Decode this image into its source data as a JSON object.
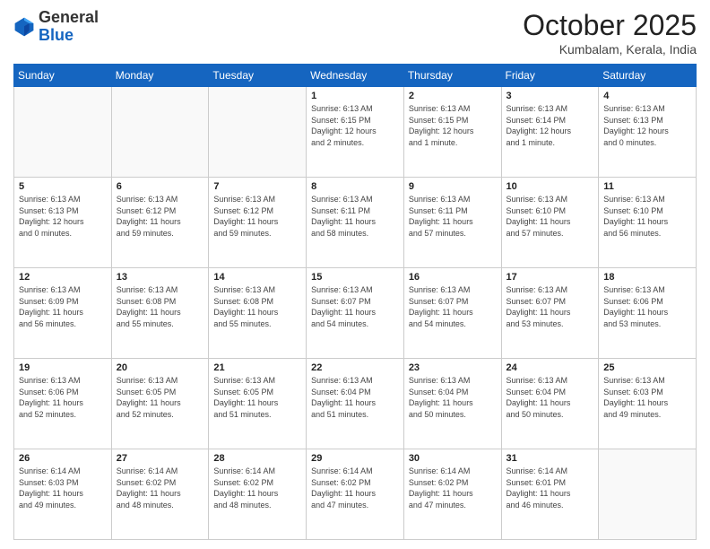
{
  "header": {
    "logo_general": "General",
    "logo_blue": "Blue",
    "month": "October 2025",
    "location": "Kumbalam, Kerala, India"
  },
  "weekdays": [
    "Sunday",
    "Monday",
    "Tuesday",
    "Wednesday",
    "Thursday",
    "Friday",
    "Saturday"
  ],
  "weeks": [
    [
      {
        "day": "",
        "info": ""
      },
      {
        "day": "",
        "info": ""
      },
      {
        "day": "",
        "info": ""
      },
      {
        "day": "1",
        "info": "Sunrise: 6:13 AM\nSunset: 6:15 PM\nDaylight: 12 hours\nand 2 minutes."
      },
      {
        "day": "2",
        "info": "Sunrise: 6:13 AM\nSunset: 6:15 PM\nDaylight: 12 hours\nand 1 minute."
      },
      {
        "day": "3",
        "info": "Sunrise: 6:13 AM\nSunset: 6:14 PM\nDaylight: 12 hours\nand 1 minute."
      },
      {
        "day": "4",
        "info": "Sunrise: 6:13 AM\nSunset: 6:13 PM\nDaylight: 12 hours\nand 0 minutes."
      }
    ],
    [
      {
        "day": "5",
        "info": "Sunrise: 6:13 AM\nSunset: 6:13 PM\nDaylight: 12 hours\nand 0 minutes."
      },
      {
        "day": "6",
        "info": "Sunrise: 6:13 AM\nSunset: 6:12 PM\nDaylight: 11 hours\nand 59 minutes."
      },
      {
        "day": "7",
        "info": "Sunrise: 6:13 AM\nSunset: 6:12 PM\nDaylight: 11 hours\nand 59 minutes."
      },
      {
        "day": "8",
        "info": "Sunrise: 6:13 AM\nSunset: 6:11 PM\nDaylight: 11 hours\nand 58 minutes."
      },
      {
        "day": "9",
        "info": "Sunrise: 6:13 AM\nSunset: 6:11 PM\nDaylight: 11 hours\nand 57 minutes."
      },
      {
        "day": "10",
        "info": "Sunrise: 6:13 AM\nSunset: 6:10 PM\nDaylight: 11 hours\nand 57 minutes."
      },
      {
        "day": "11",
        "info": "Sunrise: 6:13 AM\nSunset: 6:10 PM\nDaylight: 11 hours\nand 56 minutes."
      }
    ],
    [
      {
        "day": "12",
        "info": "Sunrise: 6:13 AM\nSunset: 6:09 PM\nDaylight: 11 hours\nand 56 minutes."
      },
      {
        "day": "13",
        "info": "Sunrise: 6:13 AM\nSunset: 6:08 PM\nDaylight: 11 hours\nand 55 minutes."
      },
      {
        "day": "14",
        "info": "Sunrise: 6:13 AM\nSunset: 6:08 PM\nDaylight: 11 hours\nand 55 minutes."
      },
      {
        "day": "15",
        "info": "Sunrise: 6:13 AM\nSunset: 6:07 PM\nDaylight: 11 hours\nand 54 minutes."
      },
      {
        "day": "16",
        "info": "Sunrise: 6:13 AM\nSunset: 6:07 PM\nDaylight: 11 hours\nand 54 minutes."
      },
      {
        "day": "17",
        "info": "Sunrise: 6:13 AM\nSunset: 6:07 PM\nDaylight: 11 hours\nand 53 minutes."
      },
      {
        "day": "18",
        "info": "Sunrise: 6:13 AM\nSunset: 6:06 PM\nDaylight: 11 hours\nand 53 minutes."
      }
    ],
    [
      {
        "day": "19",
        "info": "Sunrise: 6:13 AM\nSunset: 6:06 PM\nDaylight: 11 hours\nand 52 minutes."
      },
      {
        "day": "20",
        "info": "Sunrise: 6:13 AM\nSunset: 6:05 PM\nDaylight: 11 hours\nand 52 minutes."
      },
      {
        "day": "21",
        "info": "Sunrise: 6:13 AM\nSunset: 6:05 PM\nDaylight: 11 hours\nand 51 minutes."
      },
      {
        "day": "22",
        "info": "Sunrise: 6:13 AM\nSunset: 6:04 PM\nDaylight: 11 hours\nand 51 minutes."
      },
      {
        "day": "23",
        "info": "Sunrise: 6:13 AM\nSunset: 6:04 PM\nDaylight: 11 hours\nand 50 minutes."
      },
      {
        "day": "24",
        "info": "Sunrise: 6:13 AM\nSunset: 6:04 PM\nDaylight: 11 hours\nand 50 minutes."
      },
      {
        "day": "25",
        "info": "Sunrise: 6:13 AM\nSunset: 6:03 PM\nDaylight: 11 hours\nand 49 minutes."
      }
    ],
    [
      {
        "day": "26",
        "info": "Sunrise: 6:14 AM\nSunset: 6:03 PM\nDaylight: 11 hours\nand 49 minutes."
      },
      {
        "day": "27",
        "info": "Sunrise: 6:14 AM\nSunset: 6:02 PM\nDaylight: 11 hours\nand 48 minutes."
      },
      {
        "day": "28",
        "info": "Sunrise: 6:14 AM\nSunset: 6:02 PM\nDaylight: 11 hours\nand 48 minutes."
      },
      {
        "day": "29",
        "info": "Sunrise: 6:14 AM\nSunset: 6:02 PM\nDaylight: 11 hours\nand 47 minutes."
      },
      {
        "day": "30",
        "info": "Sunrise: 6:14 AM\nSunset: 6:02 PM\nDaylight: 11 hours\nand 47 minutes."
      },
      {
        "day": "31",
        "info": "Sunrise: 6:14 AM\nSunset: 6:01 PM\nDaylight: 11 hours\nand 46 minutes."
      },
      {
        "day": "",
        "info": ""
      }
    ]
  ]
}
